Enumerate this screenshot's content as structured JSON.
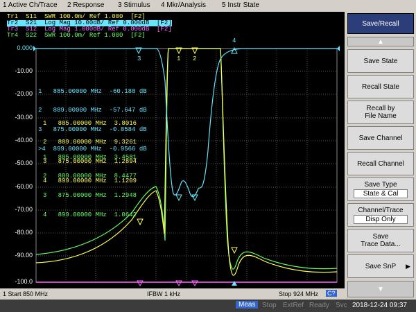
{
  "menu": [
    "1 Active Ch/Trace",
    "2 Response",
    "3 Stimulus",
    "4 Mkr/Analysis",
    "5 Instr State"
  ],
  "traces": [
    {
      "text": "Tr1  S11  SWR 100.0m/ Ref 1.000  [F2]",
      "color": "#ffff55"
    },
    {
      "text": "Tr2  S21  Log Mag 10.00dB/ Ref 0.000dB  [F2]",
      "color": "#66e6ff"
    },
    {
      "text": "Tr3  S12  Log Mag 1.000dB/ Ref 0.000dB  [F2]",
      "color": "#ff66ff"
    },
    {
      "text": "Tr4  S22  SWR 100.0m/ Ref 1.000  [F2]",
      "color": "#66ff66"
    }
  ],
  "y_labels": [
    "0.000",
    "-10.00",
    "-20.00",
    "-30.00",
    "-40.00",
    "-50.00",
    "-60.00",
    "-70.00",
    "-80.00",
    "-90.00",
    "-100.0"
  ],
  "marker_tables": [
    {
      "color": "#66e6ff",
      "rows": [
        "1   885.00000 MHz  -60.188 dB",
        "2   889.00000 MHz  -57.647 dB",
        "3   875.00000 MHz  -0.8584 dB",
        ">4  899.00000 MHz  -0.9566 dB"
      ]
    },
    {
      "color": "#ffff55",
      "rows": [
        "1   885.00000 MHz  3.8016",
        "2   889.00000 MHz  9.3261",
        "3   875.00000 MHz  1.2894",
        "4   899.00000 MHz  1.1209"
      ]
    },
    {
      "color": "#66ff66",
      "rows": [
        "1   885.00000 MHz  3.4581",
        "2   889.00000 MHz  8.4477",
        "3   875.00000 MHz  1.2948",
        "4   899.00000 MHz  1.0642"
      ]
    }
  ],
  "marker_labels": {
    "m1": "1",
    "m2": "2",
    "m3": "3",
    "m4": "4"
  },
  "status": {
    "start": "1  Start 850 MHz",
    "ifbw": "IFBW 1 kHz",
    "stop": "Stop 924 MHz",
    "cal": "C?"
  },
  "bottom": {
    "meas": "Meas",
    "stop": "Stop",
    "ext": "ExtRef",
    "ready": "Ready",
    "svc": "Svc",
    "datetime": "2018-12-24 09:37"
  },
  "softkeys": {
    "title": "Save/Recall",
    "save_state": "Save State",
    "recall_state": "Recall State",
    "recall_by_1": "Recall by",
    "recall_by_2": "File Name",
    "save_channel": "Save Channel",
    "recall_channel": "Recall Channel",
    "save_type": "Save Type",
    "save_type_val": "State & Cal",
    "ch_trace": "Channel/Trace",
    "ch_trace_val": "Disp Only",
    "save_trace_1": "Save",
    "save_trace_2": "Trace Data...",
    "save_snp": "Save SnP"
  },
  "colors": {
    "tr1": "#ffff55",
    "tr2": "#66e6ff",
    "tr3": "#ff66ff",
    "tr4": "#66ff66"
  }
}
